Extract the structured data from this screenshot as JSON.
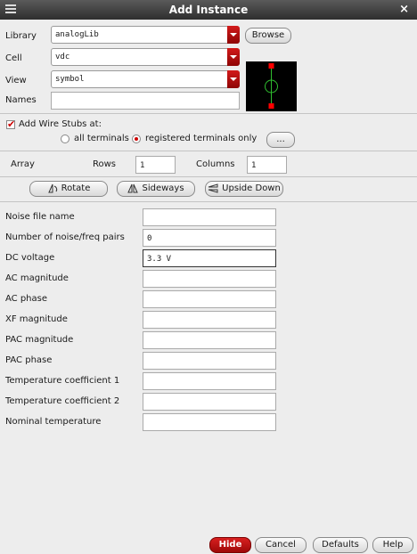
{
  "window": {
    "title": "Add Instance",
    "close_symbol": "×"
  },
  "fields": {
    "library": {
      "label": "Library",
      "value": "analogLib",
      "button": "Browse"
    },
    "cell": {
      "label": "Cell",
      "value": "vdc"
    },
    "view": {
      "label": "View",
      "value": "symbol"
    },
    "names": {
      "label": "Names",
      "value": ""
    }
  },
  "wire_stubs": {
    "label": "Add Wire Stubs at:",
    "checked": true,
    "option_all": "all terminals",
    "option_registered": "registered terminals only",
    "selected": "registered terminals only",
    "more_button": "..."
  },
  "array": {
    "label": "Array",
    "rows_label": "Rows",
    "rows": "1",
    "columns_label": "Columns",
    "columns": "1"
  },
  "transform_buttons": {
    "rotate": "Rotate",
    "sideways": "Sideways",
    "upside_down": "Upside Down"
  },
  "params": [
    {
      "label": "Noise file name",
      "value": ""
    },
    {
      "label": "Number of noise/freq pairs",
      "value": "0"
    },
    {
      "label": "DC voltage",
      "value": "3.3 V"
    },
    {
      "label": "AC magnitude",
      "value": ""
    },
    {
      "label": "AC phase",
      "value": ""
    },
    {
      "label": "XF magnitude",
      "value": ""
    },
    {
      "label": "PAC magnitude",
      "value": ""
    },
    {
      "label": "PAC phase",
      "value": ""
    },
    {
      "label": "Temperature coefficient 1",
      "value": ""
    },
    {
      "label": "Temperature coefficient 2",
      "value": ""
    },
    {
      "label": "Nominal temperature",
      "value": ""
    }
  ],
  "footer": {
    "hide": "Hide",
    "cancel": "Cancel",
    "defaults": "Defaults",
    "help": "Help"
  },
  "colors": {
    "accent": "#b80f0f",
    "symbol_line": "#2fbf2f",
    "symbol_pin": "#ff0000"
  }
}
